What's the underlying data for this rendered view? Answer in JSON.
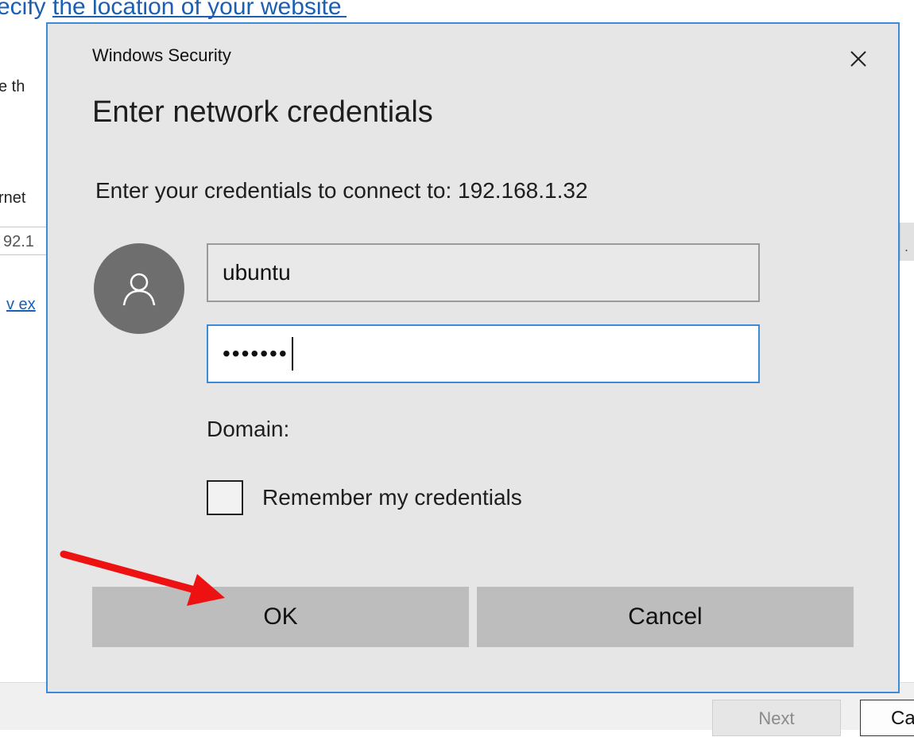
{
  "background": {
    "heading": "ecify the location of your website",
    "text_fragments": [
      "e th",
      "rnet",
      "92.1",
      "v ex"
    ],
    "next_label": "Next",
    "cancel_label": "Ca"
  },
  "dialog": {
    "title": "Windows Security",
    "heading": "Enter network credentials",
    "message": "Enter your credentials to connect to: 192.168.1.32",
    "username": "ubuntu",
    "password_mask": "•••••••",
    "domain_label": "Domain:",
    "remember_label": "Remember my credentials",
    "remember_checked": false,
    "ok_label": "OK",
    "cancel_label": "Cancel",
    "icons": [
      "close-icon",
      "user-avatar-icon"
    ]
  },
  "annotation": {
    "type": "arrow",
    "color": "#ee1111",
    "target": "ok-button"
  },
  "colors": {
    "dialog_border": "#3c8bd9",
    "dialog_bg": "#e6e6e6",
    "button_bg": "#bdbdbd",
    "link": "#1a5fb4"
  }
}
